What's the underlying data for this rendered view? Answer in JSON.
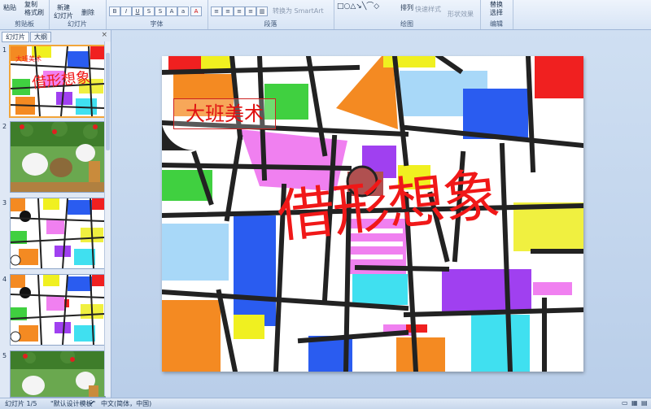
{
  "ribbon": {
    "clipboard": {
      "paste": "粘贴",
      "copy": "复制",
      "format_painter": "格式刷",
      "label": "剪贴板"
    },
    "slides": {
      "new_slide": "新建",
      "new_slide2": "幻灯片",
      "delete": "删除",
      "label": "幻灯片"
    },
    "font": {
      "label": "字体"
    },
    "paragraph": {
      "label": "段落",
      "convert_smartart": "转换为 SmartArt"
    },
    "drawing": {
      "label": "绘图",
      "arrange": "排列",
      "quick_styles": "快速样式",
      "shape_effects": "形状效果"
    },
    "editing": {
      "label": "编辑",
      "replace": "替换",
      "select": "选择"
    }
  },
  "panel": {
    "tabs": [
      "幻灯片",
      "大纲"
    ],
    "close": "×",
    "thumb_numbers": [
      "1",
      "2",
      "3",
      "4",
      "5"
    ]
  },
  "slide": {
    "subtitle": "大班美术",
    "title": "借形想象"
  },
  "status": {
    "slide_info": "幻灯片 1/5",
    "theme": "\"默认设计模板\"",
    "language": "中文(简体，中国)"
  },
  "colors": {
    "ribbon_bg": "#d7e4f5",
    "accent_red": "#f01818",
    "selection": "#f2a53a"
  }
}
